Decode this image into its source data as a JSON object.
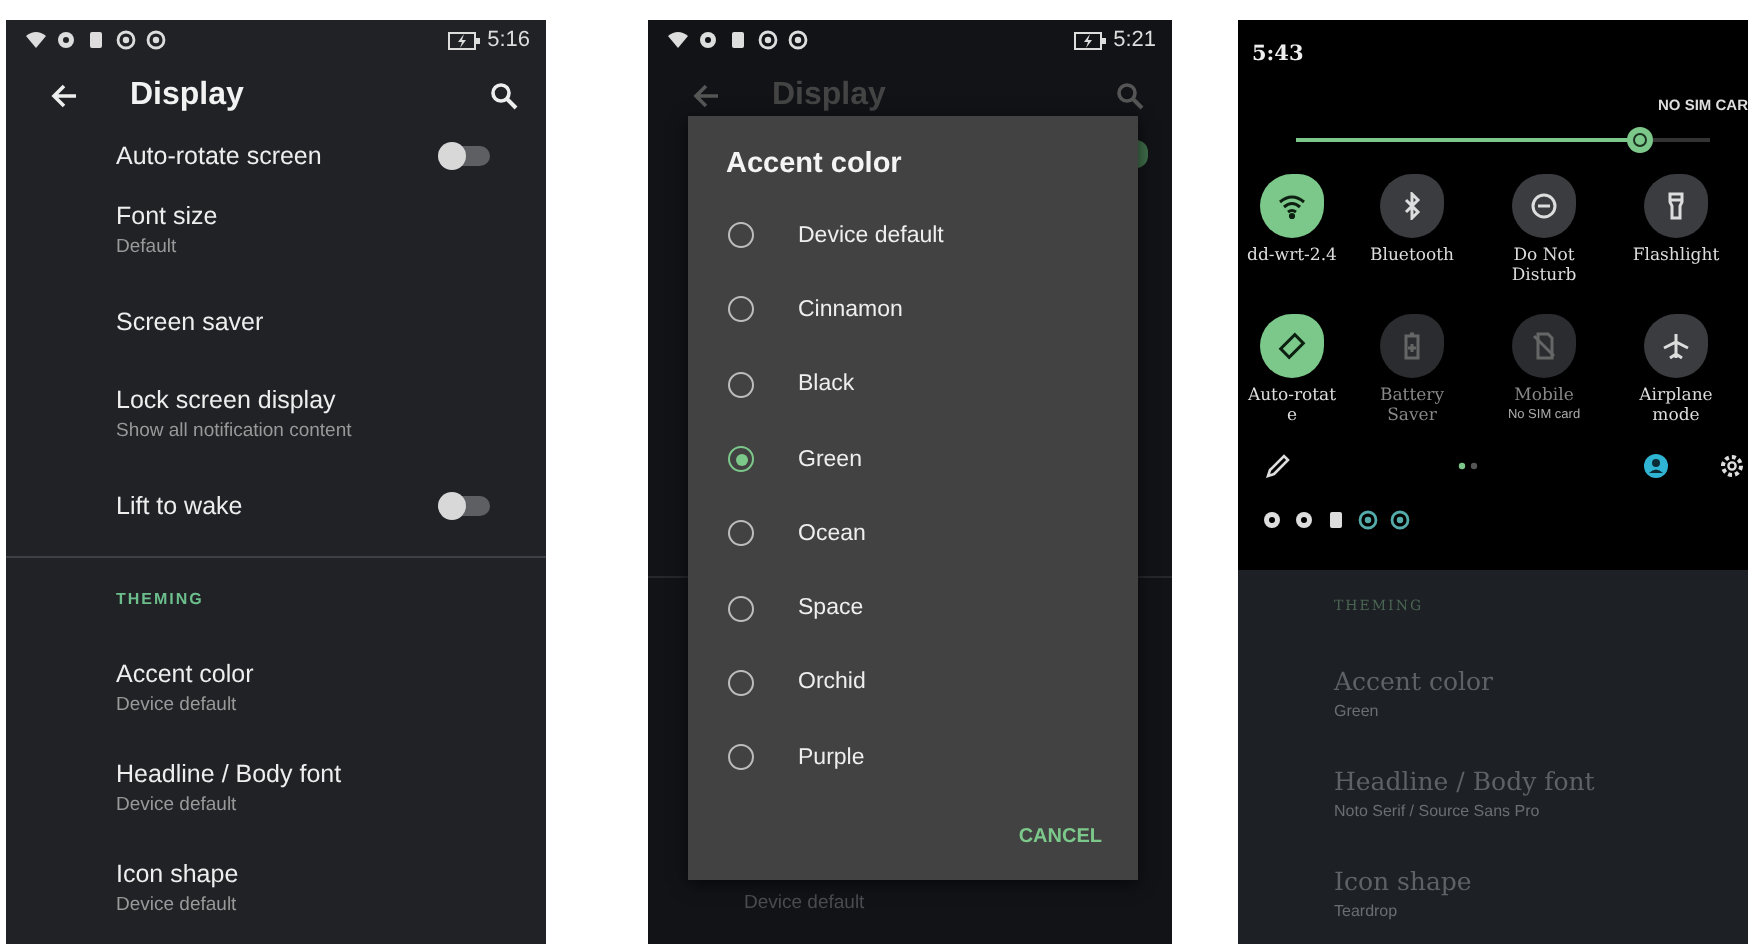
{
  "settings_screen": {
    "status_bar": {
      "time": "5:16"
    },
    "app_bar": {
      "title": "Display"
    },
    "items": [
      {
        "kind": "toggle",
        "title": "Auto-rotate screen",
        "on": false
      },
      {
        "kind": "text",
        "title": "Font size",
        "summary": "Default"
      },
      {
        "kind": "text",
        "title": "Screen saver"
      },
      {
        "kind": "text",
        "title": "Lock screen display",
        "summary": "Show all notification content"
      },
      {
        "kind": "toggle",
        "title": "Lift to wake",
        "on": false
      },
      {
        "kind": "divider"
      },
      {
        "kind": "header",
        "title": "THEMING"
      },
      {
        "kind": "text",
        "title": "Accent color",
        "summary": "Device default"
      },
      {
        "kind": "text",
        "title": "Headline / Body font",
        "summary": "Device default"
      },
      {
        "kind": "text",
        "title": "Icon shape",
        "summary": "Device default"
      }
    ]
  },
  "dialog_screen": {
    "status_bar": {
      "time": "5:21"
    },
    "app_bar": {
      "title": "Display"
    },
    "background_toggle": {
      "on": true
    },
    "dialog": {
      "title": "Accent color",
      "options": [
        {
          "label": "Device default",
          "selected": false
        },
        {
          "label": "Cinnamon",
          "selected": false
        },
        {
          "label": "Black",
          "selected": false
        },
        {
          "label": "Green",
          "selected": true
        },
        {
          "label": "Ocean",
          "selected": false
        },
        {
          "label": "Space",
          "selected": false
        },
        {
          "label": "Orchid",
          "selected": false
        },
        {
          "label": "Purple",
          "selected": false
        }
      ],
      "cancel": "CANCEL"
    },
    "background_summary": "Device default"
  },
  "quick_settings_screen": {
    "time": "5:43",
    "carrier": "NO SIM CAR",
    "brightness": {
      "level": 0.83
    },
    "tiles": [
      {
        "kind": "wifi",
        "label": "dd-wrt-2.4",
        "on": true,
        "disabled": false
      },
      {
        "kind": "bluetooth",
        "label": "Bluetooth",
        "on": false,
        "disabled": false
      },
      {
        "kind": "dnd",
        "label": "Do Not Disturb",
        "on": false,
        "disabled": false
      },
      {
        "kind": "flashlight",
        "label": "Flashlight",
        "on": false,
        "disabled": false
      },
      {
        "kind": "rotate",
        "label": "Auto-rotat e",
        "on": true,
        "disabled": false
      },
      {
        "kind": "battery",
        "label": "Battery Saver",
        "on": false,
        "disabled": true
      },
      {
        "kind": "mobile",
        "label": "Mobile",
        "sublabel": "No SIM card",
        "on": false,
        "disabled": true
      },
      {
        "kind": "airplane",
        "label": "Airplane mode",
        "on": false,
        "disabled": false
      }
    ],
    "items": [
      {
        "kind": "header",
        "title": "THEMING"
      },
      {
        "kind": "text",
        "title": "Accent color",
        "summary": "Green"
      },
      {
        "kind": "text",
        "title": "Headline / Body font",
        "summary": "Noto Serif / Source Sans Pro"
      },
      {
        "kind": "text",
        "title": "Icon shape",
        "summary": "Teardrop"
      }
    ]
  }
}
